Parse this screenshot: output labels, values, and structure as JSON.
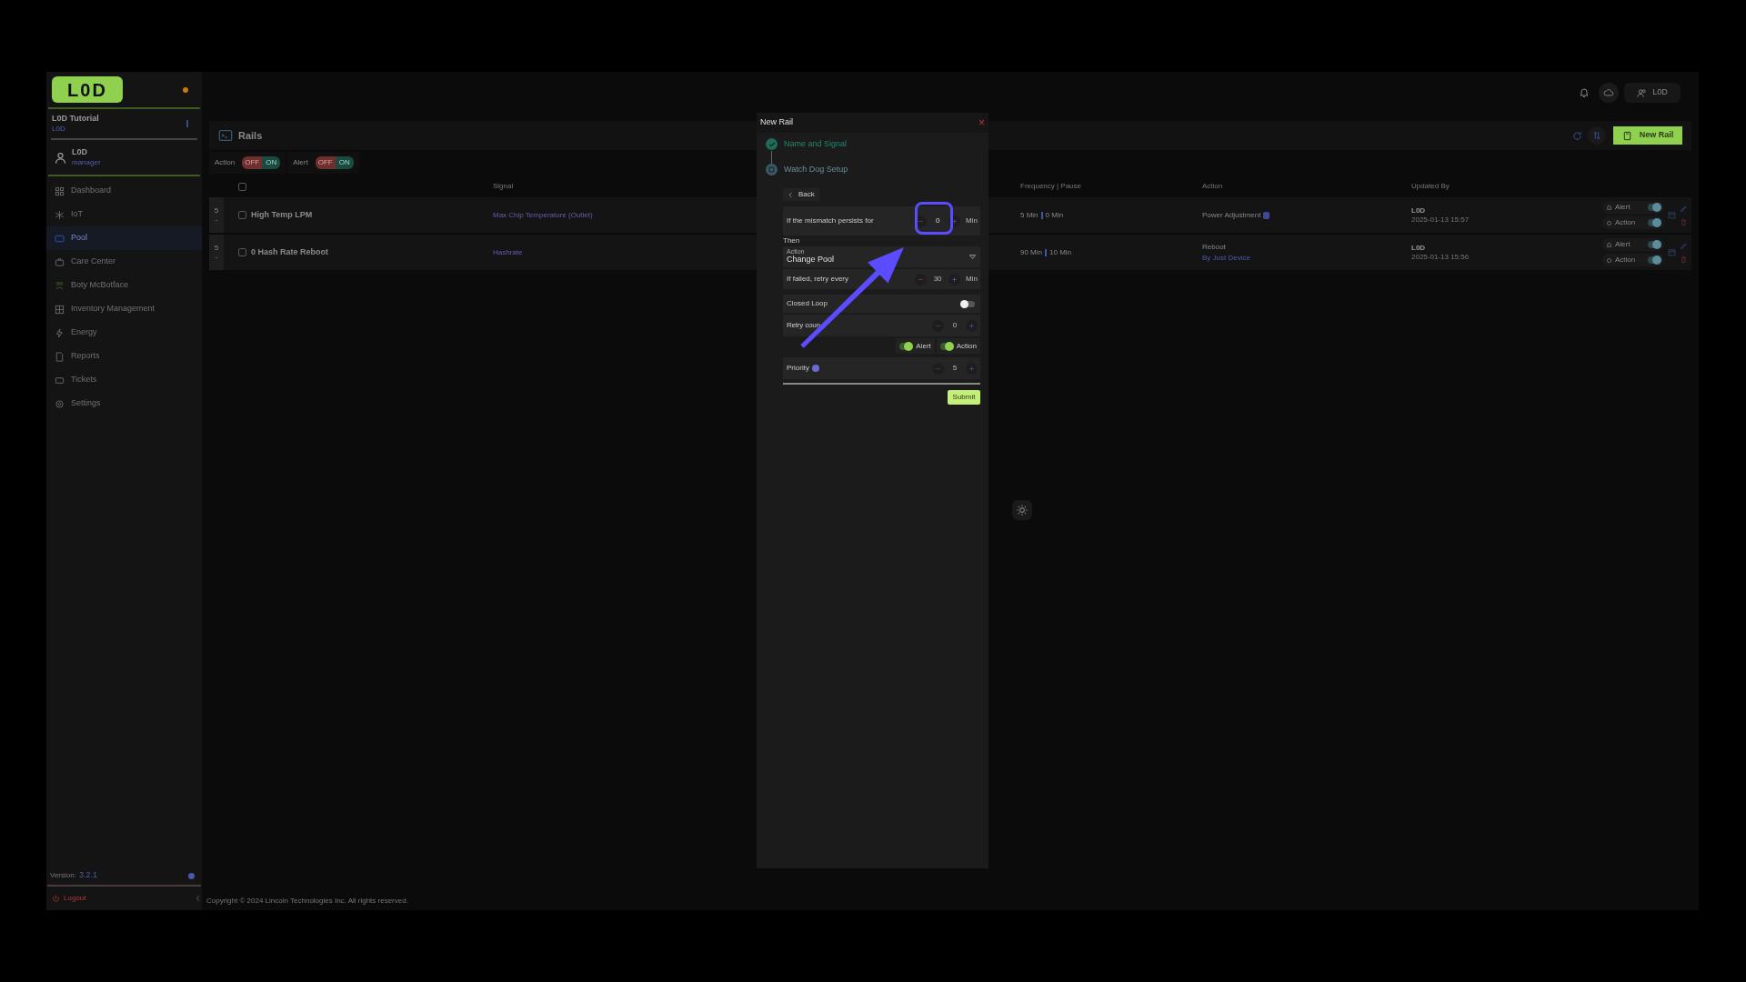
{
  "sidebar": {
    "logo": "L0D",
    "workspace": {
      "name": "L0D Tutorial",
      "sub": "L0D"
    },
    "user": {
      "name": "L0D",
      "role": "manager"
    },
    "nav": [
      {
        "label": "Dashboard",
        "selected": false
      },
      {
        "label": "IoT",
        "selected": false
      },
      {
        "label": "Pool",
        "selected": true
      },
      {
        "label": "Care Center",
        "selected": false
      },
      {
        "label": "Boty McBotface",
        "selected": false
      },
      {
        "label": "Inventory Management",
        "selected": false
      },
      {
        "label": "Energy",
        "selected": false
      },
      {
        "label": "Reports",
        "selected": false
      },
      {
        "label": "Tickets",
        "selected": false
      },
      {
        "label": "Settings",
        "selected": false
      }
    ],
    "version_label": "Version:",
    "version": "3.2.1",
    "logout": "Logout"
  },
  "topbar": {
    "user": "L0D"
  },
  "page": {
    "title": "Rails",
    "filters": [
      {
        "label": "Action",
        "off": "OFF",
        "on": "ON"
      },
      {
        "label": "Alert",
        "off": "OFF",
        "on": "ON"
      }
    ],
    "new_button": "New Rail"
  },
  "table": {
    "select_all_checked": false,
    "columns": [
      "Signal",
      "Frequency | Pause",
      "Action",
      "Updated By"
    ],
    "rows": [
      {
        "checked": false,
        "priority": "5",
        "dash": "-",
        "name": "High Temp LPM",
        "signal": "Max Chip Temperature (Outlet)",
        "frequency": "5 Min",
        "pause": "0 Min",
        "action": "Power Adjustment",
        "action_sub": "",
        "updated_by": "L0D",
        "updated_at": "2025-01-13 15:57",
        "alert_label": "Alert",
        "action_label": "Action",
        "alert_on": true,
        "action_on": true
      },
      {
        "checked": false,
        "priority": "5",
        "dash": "-",
        "name": "0 Hash Rate Reboot",
        "signal": "Hashrate",
        "frequency": "90 Min",
        "pause": "10 Min",
        "action": "Reboot",
        "action_sub": "By Just Device",
        "updated_by": "L0D",
        "updated_at": "2025-01-13 15:56",
        "alert_label": "Alert",
        "action_label": "Action",
        "alert_on": true,
        "action_on": true
      }
    ]
  },
  "footer": "Copyright © 2024 Lincoin Technologies Inc. All rights reserved.",
  "modal": {
    "title": "New Rail",
    "close": "×",
    "steps": [
      {
        "label": "Name and Signal",
        "done": true
      },
      {
        "label": "Watch Dog Setup",
        "done": false
      }
    ],
    "back": "Back",
    "persist": {
      "label": "If the mismatch persists for",
      "value": "0",
      "unit": "Min"
    },
    "then": "Then",
    "action_select": {
      "label": "Action",
      "value": "Change Pool"
    },
    "retry": {
      "label": "If failed, retry every",
      "value": "30",
      "unit": "Min"
    },
    "closed_loop": {
      "label": "Closed Loop",
      "on": false
    },
    "retry_count": {
      "label": "Retry coun",
      "value": "0"
    },
    "toggles": [
      {
        "label": "Alert",
        "on": true
      },
      {
        "label": "Action",
        "on": true
      }
    ],
    "priority": {
      "label": "Priority",
      "value": "5"
    },
    "submit": "Submit"
  }
}
